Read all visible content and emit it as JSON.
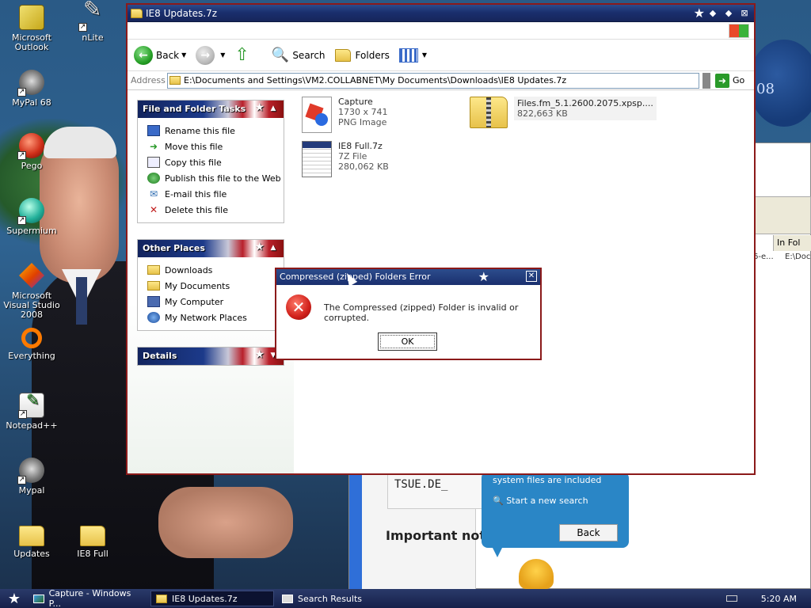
{
  "desktop": {
    "icons": [
      {
        "label": "Microsoft Outlook"
      },
      {
        "label": "nLite"
      },
      {
        "label": "MyPal 68"
      },
      {
        "label": "Pego"
      },
      {
        "label": "Supermium"
      },
      {
        "label": "Microsoft Visual Studio 2008"
      },
      {
        "label": "Everything"
      },
      {
        "label": "Notepad++"
      },
      {
        "label": "Mypal"
      },
      {
        "label": "Updates"
      },
      {
        "label": "IE8 Full"
      }
    ],
    "wallpaper_text": "08"
  },
  "explorer": {
    "title": "IE8 Updates.7z",
    "toolbar": {
      "back": "Back",
      "search": "Search",
      "folders": "Folders"
    },
    "address": {
      "label": "Address",
      "value": "E:\\Documents and Settings\\VM2.COLLABNET\\My Documents\\Downloads\\IE8 Updates.7z",
      "go": "Go"
    },
    "file_tasks": {
      "header": "File and Folder Tasks",
      "items": [
        "Rename this file",
        "Move this file",
        "Copy this file",
        "Publish this file to the Web",
        "E-mail this file",
        "Delete this file"
      ]
    },
    "other_places": {
      "header": "Other Places",
      "items": [
        "Downloads",
        "My Documents",
        "My Computer",
        "My Network Places"
      ]
    },
    "details": {
      "header": "Details"
    },
    "files": [
      {
        "name": "Capture",
        "line2": "1730 x 741",
        "line3": "PNG Image"
      },
      {
        "name": "Files.fm_5.1.2600.2075.xpsp....",
        "line2": "822,663 KB"
      },
      {
        "name": "IE8 Full.7z",
        "line2": "7Z File",
        "line3": "280,062 KB"
      }
    ]
  },
  "dialog": {
    "title": "Compressed (zipped) Folders Error",
    "message": "The Compressed (zipped) Folder is invalid or corrupted.",
    "ok": "OK"
  },
  "background_window": {
    "column_header": "In Fol",
    "cell1": "6-e...",
    "cell2": "E:\\Doc",
    "code": "TSUE.DE_",
    "heading": "Important not",
    "assistant": {
      "line1": "system files are included",
      "line2": "Start a new search",
      "back": "Back"
    }
  },
  "taskbar": {
    "items": [
      {
        "label": "Capture - Windows P..."
      },
      {
        "label": "IE8 Updates.7z"
      },
      {
        "label": "Search Results"
      }
    ],
    "clock": "5:20 AM"
  }
}
